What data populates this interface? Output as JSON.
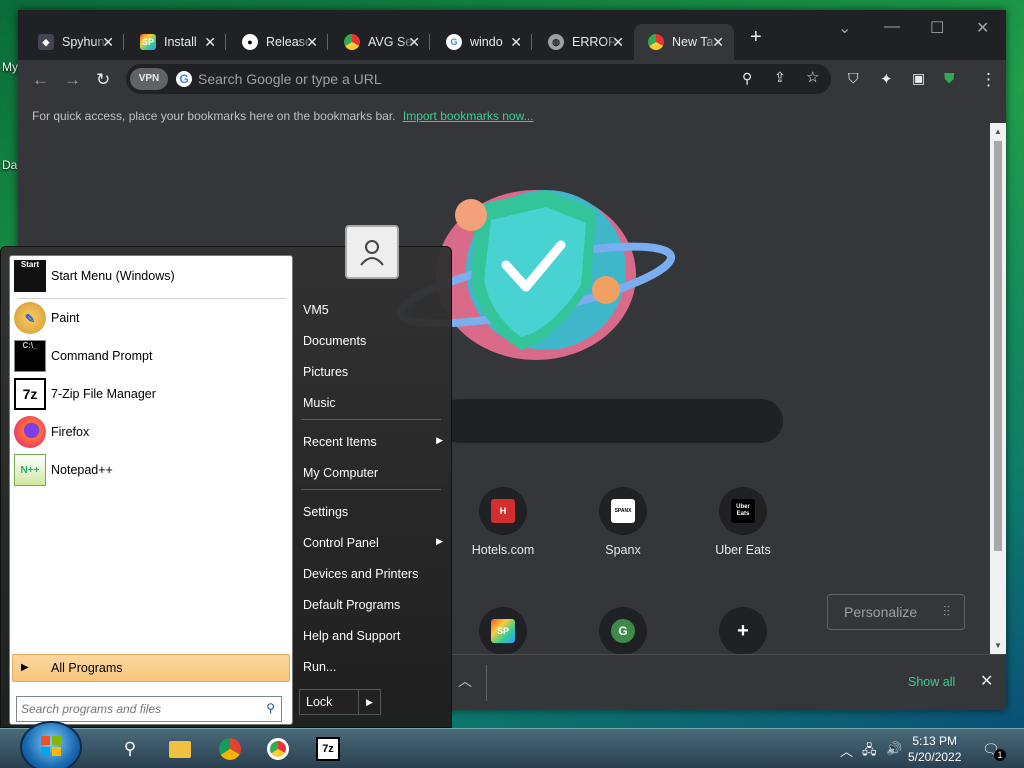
{
  "desktop": {
    "icon1_label": "My",
    "icon2_label": "Da"
  },
  "browser": {
    "tabs": [
      {
        "title": "Spyhunter",
        "favicon": "spyhunter-icon"
      },
      {
        "title": "Install",
        "favicon": "sp-icon"
      },
      {
        "title": "Release",
        "favicon": "github-icon"
      },
      {
        "title": "AVG Se",
        "favicon": "avg-chrome-icon"
      },
      {
        "title": "windo",
        "favicon": "google-icon"
      },
      {
        "title": "ERROR",
        "favicon": "globe-icon"
      },
      {
        "title": "New Ta",
        "favicon": "avg-chrome-icon"
      }
    ],
    "vpn_label": "VPN",
    "omnibox_placeholder": "Search Google or type a URL",
    "bookmarks_hint": "For quick access, place your bookmarks here on the bookmarks bar.",
    "import_link": "Import bookmarks now...",
    "shortcuts": [
      {
        "label": "Hotels.com",
        "icon": "hotels-icon",
        "color": "#d32f2f"
      },
      {
        "label": "Spanx",
        "icon": "spanx-icon",
        "color": "#ffffff",
        "text": "SPANX"
      },
      {
        "label": "Uber Eats",
        "icon": "uber-eats-icon",
        "color": "#000000",
        "text": "Uber Eats"
      }
    ],
    "shortcuts_row2": [
      {
        "icon": "sp-icon",
        "text": "SP"
      },
      {
        "icon": "g-icon",
        "text": "G"
      },
      {
        "icon": "add-shortcut-icon",
        "text": "+"
      }
    ],
    "personalize_label": "Personalize",
    "show_all_label": "Show all"
  },
  "start_menu": {
    "pinned": [
      {
        "label": "Start Menu (Windows)",
        "icon": "start-menu-icon"
      },
      {
        "label": "Paint",
        "icon": "paint-icon"
      },
      {
        "label": "Command Prompt",
        "icon": "cmd-icon"
      },
      {
        "label": "7-Zip File Manager",
        "icon": "7zip-icon"
      },
      {
        "label": "Firefox",
        "icon": "firefox-icon"
      },
      {
        "label": "Notepad++",
        "icon": "notepadpp-icon"
      }
    ],
    "all_programs": "All Programs",
    "search_placeholder": "Search programs and files",
    "right": [
      {
        "label": "VM5"
      },
      {
        "label": "Documents"
      },
      {
        "label": "Pictures"
      },
      {
        "label": "Music"
      },
      {
        "label": "Recent Items",
        "submenu": true
      },
      {
        "label": "My Computer"
      },
      {
        "label": "Settings"
      },
      {
        "label": "Control Panel",
        "submenu": true
      },
      {
        "label": "Devices and Printers"
      },
      {
        "label": "Default Programs"
      },
      {
        "label": "Help and Support"
      },
      {
        "label": "Run..."
      }
    ],
    "lock_label": "Lock",
    "start_icon_text": "Start"
  },
  "taskbar": {
    "time": "5:13 PM",
    "date": "5/20/2022",
    "notification_count": "1",
    "apps": [
      "search-icon",
      "file-explorer-icon",
      "chrome-icon",
      "avg-browser-icon",
      "7zip-icon"
    ]
  }
}
